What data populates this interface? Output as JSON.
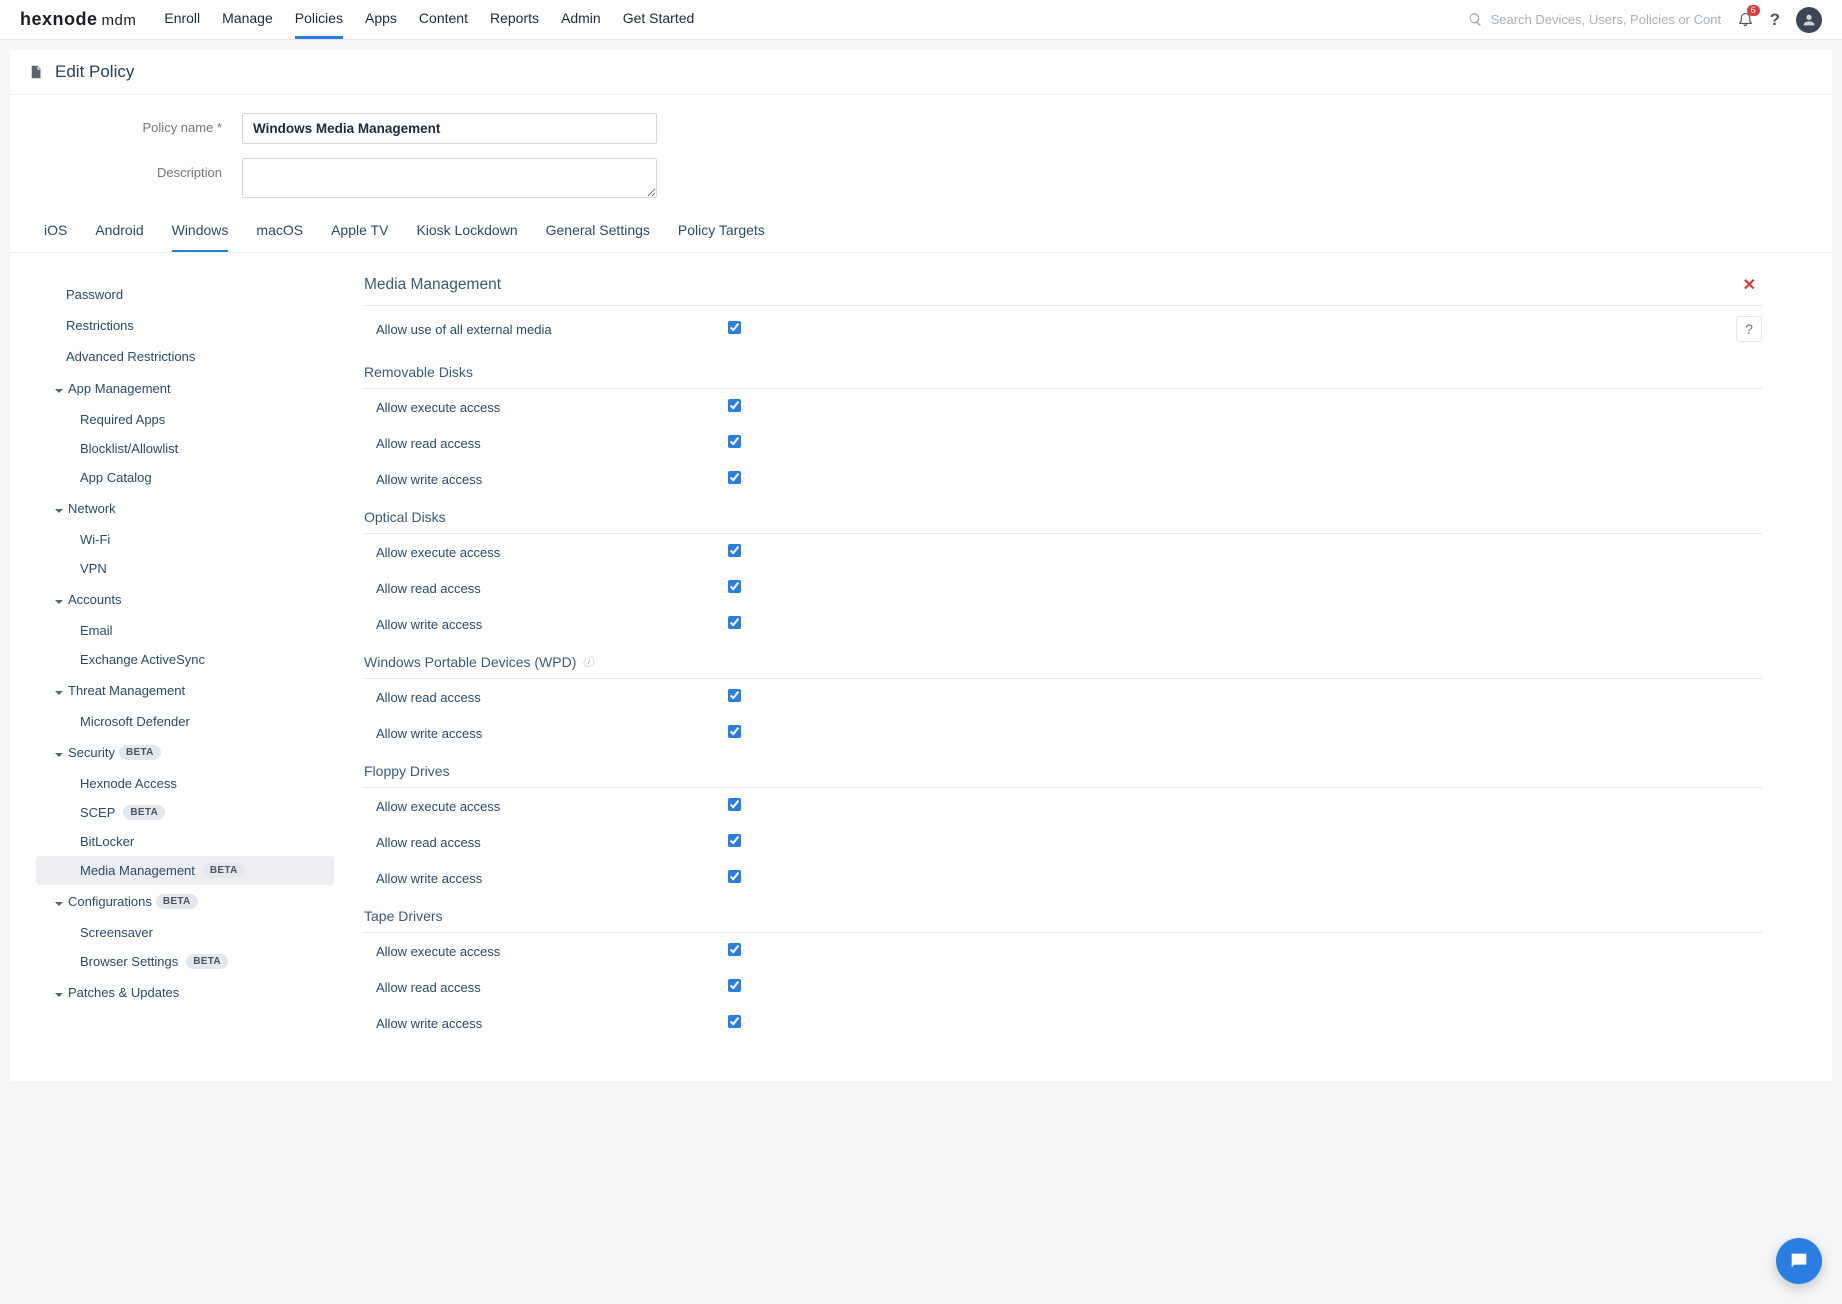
{
  "brand": {
    "name": "hexnode",
    "suffix": "mdm"
  },
  "topnav": [
    "Enroll",
    "Manage",
    "Policies",
    "Apps",
    "Content",
    "Reports",
    "Admin",
    "Get Started"
  ],
  "topnav_active": 2,
  "search": {
    "placeholder": "Search Devices, Users, Policies or Content"
  },
  "notifications": {
    "count": "6"
  },
  "page": {
    "title": "Edit Policy"
  },
  "form": {
    "name_label": "Policy name *",
    "name_value": "Windows Media Management",
    "desc_label": "Description",
    "desc_value": ""
  },
  "platform_tabs": [
    "iOS",
    "Android",
    "Windows",
    "macOS",
    "Apple TV",
    "Kiosk Lockdown",
    "General Settings",
    "Policy Targets"
  ],
  "platform_active": 2,
  "sidebar": {
    "top_items": [
      "Password",
      "Restrictions",
      "Advanced Restrictions"
    ],
    "groups": [
      {
        "label": "App Management",
        "beta": false,
        "items": [
          {
            "label": "Required Apps"
          },
          {
            "label": "Blocklist/Allowlist"
          },
          {
            "label": "App Catalog"
          }
        ]
      },
      {
        "label": "Network",
        "beta": false,
        "items": [
          {
            "label": "Wi-Fi"
          },
          {
            "label": "VPN"
          }
        ]
      },
      {
        "label": "Accounts",
        "beta": false,
        "items": [
          {
            "label": "Email"
          },
          {
            "label": "Exchange ActiveSync"
          }
        ]
      },
      {
        "label": "Threat Management",
        "beta": false,
        "items": [
          {
            "label": "Microsoft Defender"
          }
        ]
      },
      {
        "label": "Security",
        "beta": true,
        "items": [
          {
            "label": "Hexnode Access"
          },
          {
            "label": "SCEP",
            "beta": true
          },
          {
            "label": "BitLocker"
          },
          {
            "label": "Media Management",
            "beta": true,
            "selected": true
          }
        ]
      },
      {
        "label": "Configurations",
        "beta": true,
        "items": [
          {
            "label": "Screensaver"
          },
          {
            "label": "Browser Settings",
            "beta": true
          }
        ]
      },
      {
        "label": "Patches & Updates",
        "beta": false,
        "items": []
      }
    ]
  },
  "content": {
    "title": "Media Management",
    "global": {
      "label": "Allow use of all external media",
      "checked": true,
      "help": true
    },
    "sections": [
      {
        "title": "Removable Disks",
        "items": [
          {
            "label": "Allow execute access",
            "checked": true
          },
          {
            "label": "Allow read access",
            "checked": true
          },
          {
            "label": "Allow write access",
            "checked": true
          }
        ]
      },
      {
        "title": "Optical Disks",
        "items": [
          {
            "label": "Allow execute access",
            "checked": true
          },
          {
            "label": "Allow read access",
            "checked": true
          },
          {
            "label": "Allow write access",
            "checked": true
          }
        ]
      },
      {
        "title": "Windows Portable Devices (WPD)",
        "info": true,
        "items": [
          {
            "label": "Allow read access",
            "checked": true
          },
          {
            "label": "Allow write access",
            "checked": true
          }
        ]
      },
      {
        "title": "Floppy Drives",
        "items": [
          {
            "label": "Allow execute access",
            "checked": true
          },
          {
            "label": "Allow read access",
            "checked": true
          },
          {
            "label": "Allow write access",
            "checked": true
          }
        ]
      },
      {
        "title": "Tape Drivers",
        "items": [
          {
            "label": "Allow execute access",
            "checked": true
          },
          {
            "label": "Allow read access",
            "checked": true
          },
          {
            "label": "Allow write access",
            "checked": true
          }
        ]
      }
    ]
  },
  "beta_label": "BETA"
}
